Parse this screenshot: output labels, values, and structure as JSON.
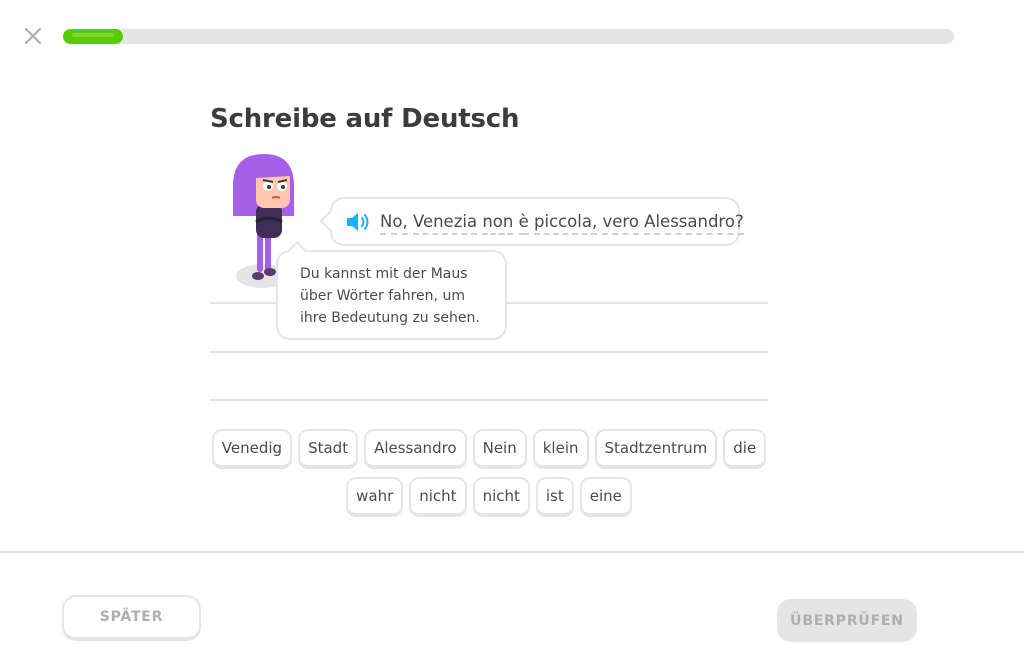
{
  "header": {
    "close_icon": "close-icon",
    "progress": {
      "fraction": 0.067,
      "color": "#58cc02"
    }
  },
  "prompt": {
    "title": "Schreibe auf Deutsch"
  },
  "speech": {
    "speaker_icon": "speaker-icon",
    "words": [
      "No,",
      "Venezia",
      "non",
      "è",
      "piccola,",
      "vero",
      "Alessandro?"
    ]
  },
  "hint": {
    "lines": [
      "Du kannst mit der Maus",
      "über Wörter fahren, um",
      "ihre Bedeutung zu sehen."
    ]
  },
  "word_bank": {
    "row1": [
      "Venedig",
      "Stadt",
      "Alessandro",
      "Nein",
      "klein",
      "Stadtzentrum",
      "die"
    ],
    "row2": [
      "wahr",
      "nicht",
      "nicht",
      "ist",
      "eine"
    ]
  },
  "footer": {
    "skip_label": "SPÄTER",
    "check_label": "ÜBERPRÜFEN"
  },
  "colors": {
    "accent": "#58cc02",
    "speaker": "#1cb0f6",
    "character": "#a560e8"
  }
}
